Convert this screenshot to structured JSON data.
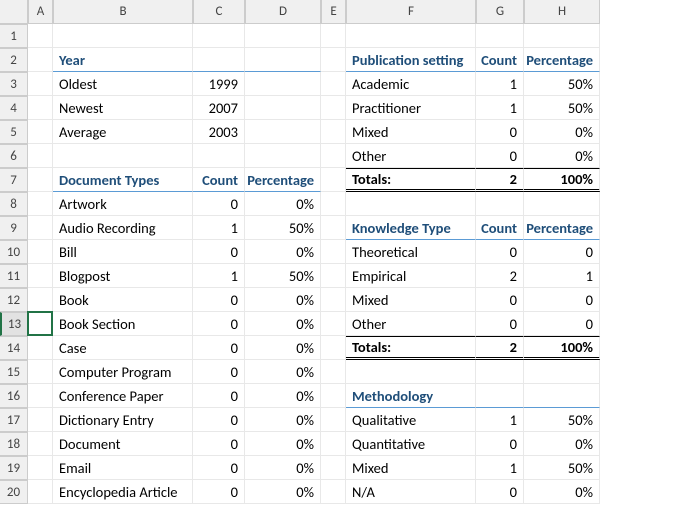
{
  "columns": [
    "A",
    "B",
    "C",
    "D",
    "E",
    "F",
    "G",
    "H"
  ],
  "rows": [
    "1",
    "2",
    "3",
    "4",
    "5",
    "6",
    "7",
    "8",
    "9",
    "10",
    "11",
    "12",
    "13",
    "14",
    "15",
    "16",
    "17",
    "18",
    "19",
    "20"
  ],
  "selectedRow": "13",
  "year": {
    "header": "Year",
    "rows": [
      {
        "label": "Oldest",
        "value": "1999"
      },
      {
        "label": "Newest",
        "value": "2007"
      },
      {
        "label": "Average",
        "value": "2003"
      }
    ]
  },
  "docTypes": {
    "header": "Document Types",
    "countHeader": "Count",
    "pctHeader": "Percentage",
    "rows": [
      {
        "l": "Artwork",
        "c": "0",
        "p": "0%"
      },
      {
        "l": "Audio Recording",
        "c": "1",
        "p": "50%"
      },
      {
        "l": "Bill",
        "c": "0",
        "p": "0%"
      },
      {
        "l": "Blogpost",
        "c": "1",
        "p": "50%"
      },
      {
        "l": "Book",
        "c": "0",
        "p": "0%"
      },
      {
        "l": "Book Section",
        "c": "0",
        "p": "0%"
      },
      {
        "l": "Case",
        "c": "0",
        "p": "0%"
      },
      {
        "l": "Computer Program",
        "c": "0",
        "p": "0%"
      },
      {
        "l": "Conference Paper",
        "c": "0",
        "p": "0%"
      },
      {
        "l": "Dictionary Entry",
        "c": "0",
        "p": "0%"
      },
      {
        "l": "Document",
        "c": "0",
        "p": "0%"
      },
      {
        "l": "Email",
        "c": "0",
        "p": "0%"
      },
      {
        "l": "Encyclopedia Article",
        "c": "0",
        "p": "0%"
      }
    ]
  },
  "pubSetting": {
    "header": "Publication setting",
    "countHeader": "Count",
    "pctHeader": "Percentage",
    "rows": [
      {
        "l": "Academic",
        "c": "1",
        "p": "50%"
      },
      {
        "l": "Practitioner",
        "c": "1",
        "p": "50%"
      },
      {
        "l": "Mixed",
        "c": "0",
        "p": "0%"
      },
      {
        "l": "Other",
        "c": "0",
        "p": "0%"
      }
    ],
    "totalsLabel": "Totals:",
    "totalsCount": "2",
    "totalsPct": "100%"
  },
  "knowledge": {
    "header": "Knowledge Type",
    "countHeader": "Count",
    "pctHeader": "Percentage",
    "rows": [
      {
        "l": "Theoretical",
        "c": "0",
        "p": "0"
      },
      {
        "l": "Empirical",
        "c": "2",
        "p": "1"
      },
      {
        "l": "Mixed",
        "c": "0",
        "p": "0"
      },
      {
        "l": "Other",
        "c": "0",
        "p": "0"
      }
    ],
    "totalsLabel": "Totals:",
    "totalsCount": "2",
    "totalsPct": "100%"
  },
  "methodology": {
    "header": "Methodology",
    "rows": [
      {
        "l": "Qualitative",
        "c": "1",
        "p": "50%"
      },
      {
        "l": "Quantitative",
        "c": "0",
        "p": "0%"
      },
      {
        "l": "Mixed",
        "c": "1",
        "p": "50%"
      },
      {
        "l": "N/A",
        "c": "0",
        "p": "0%"
      }
    ]
  }
}
